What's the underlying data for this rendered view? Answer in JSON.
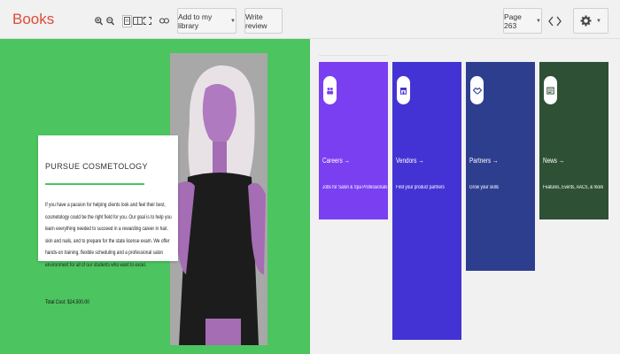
{
  "toolbar": {
    "brand": "Books",
    "add_library_label": "Add to my library",
    "write_review_label": "Write review",
    "page_label": "Page 263",
    "icons": [
      "zoom-in-icon",
      "zoom-out-icon",
      "single-page-icon",
      "two-page-icon",
      "fullscreen-icon",
      "link-icon",
      "chevron-left-icon",
      "chevron-right-icon",
      "gear-icon"
    ]
  },
  "book_page": {
    "card_title": "PURSUE COSMETOLOGY",
    "card_body": "If you have a passion for helping clients look and feel their best, cosmetology could be the right field for you. Our goal is to help you learn everything needed to succeed in a rewarding career in hair, skin and nails, and to prepare for the state license exam. We offer hands-on training, flexible scheduling and a professional salon environment for all of our students who want to excel.",
    "total_cost": "Total Cost: $24,500.00",
    "accent_color": "#4cc45f"
  },
  "tiles": [
    {
      "title": "Careers →",
      "subtitle": "Jobs for Salon & Spa Professionals",
      "color": "#7b3ff2",
      "icon": "people-icon"
    },
    {
      "title": "Vendors →",
      "subtitle": "Find your product partners",
      "color": "#4433d4",
      "icon": "store-icon"
    },
    {
      "title": "Partners →",
      "subtitle": "Grow your skills",
      "color": "#2e3e8f",
      "icon": "handshake-icon"
    },
    {
      "title": "News →",
      "subtitle": "Features, Events, AACS, & more",
      "color": "#2e5035",
      "icon": "news-icon"
    }
  ]
}
